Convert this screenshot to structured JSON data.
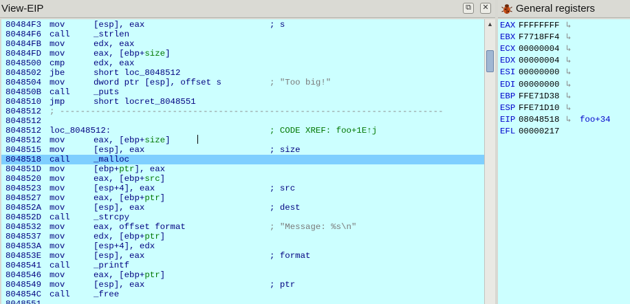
{
  "eip_view": {
    "title": "View-EIP",
    "restore_icon": "restore-window-icon",
    "close_icon": "close-window-icon",
    "lines": [
      {
        "addr": "80484F3",
        "mnem": "mov",
        "ops": "[esp], eax",
        "comment": "; s",
        "cstyle": ""
      },
      {
        "addr": "80484F6",
        "mnem": "call",
        "ops": "_strlen",
        "comment": "",
        "cstyle": ""
      },
      {
        "addr": "80484FB",
        "mnem": "mov",
        "ops": "edx, eax",
        "comment": "",
        "cstyle": ""
      },
      {
        "addr": "80484FD",
        "mnem": "mov",
        "ops": "eax, [ebp+size]",
        "comment": "",
        "cstyle": ""
      },
      {
        "addr": "8048500",
        "mnem": "cmp",
        "ops": "edx, eax",
        "comment": "",
        "cstyle": ""
      },
      {
        "addr": "8048502",
        "mnem": "jbe",
        "ops": "short loc_8048512",
        "comment": "",
        "cstyle": ""
      },
      {
        "addr": "8048504",
        "mnem": "mov",
        "ops": "dword ptr [esp], offset s",
        "comment": "; \"Too big!\"",
        "cstyle": "gray"
      },
      {
        "addr": "804850B",
        "mnem": "call",
        "ops": "_puts",
        "comment": "",
        "cstyle": ""
      },
      {
        "addr": "8048510",
        "mnem": "jmp",
        "ops": "short locret_8048551",
        "comment": "",
        "cstyle": ""
      },
      {
        "addr": "8048512",
        "mnem": "",
        "ops": "",
        "comment": "",
        "cstyle": "",
        "sep": "; ---------------------------------------------------------------------------"
      },
      {
        "addr": "8048512",
        "mnem": "",
        "ops": "",
        "comment": "",
        "cstyle": ""
      },
      {
        "addr": "8048512",
        "mnem": "loc_8048512:",
        "ops": "",
        "comment": "; CODE XREF: foo+1E↑j",
        "cstyle": "green"
      },
      {
        "addr": "8048512",
        "mnem": "mov",
        "ops": "eax, [ebp+size]",
        "comment": "",
        "cstyle": ""
      },
      {
        "addr": "8048515",
        "mnem": "mov",
        "ops": "[esp], eax",
        "comment": "; size",
        "cstyle": ""
      },
      {
        "addr": "8048518",
        "mnem": "call",
        "ops": "_malloc",
        "comment": "",
        "cstyle": "",
        "highlight": true
      },
      {
        "addr": "804851D",
        "mnem": "mov",
        "ops": "[ebp+ptr], eax",
        "comment": "",
        "cstyle": ""
      },
      {
        "addr": "8048520",
        "mnem": "mov",
        "ops": "eax, [ebp+src]",
        "comment": "",
        "cstyle": ""
      },
      {
        "addr": "8048523",
        "mnem": "mov",
        "ops": "[esp+4], eax",
        "comment": "; src",
        "cstyle": ""
      },
      {
        "addr": "8048527",
        "mnem": "mov",
        "ops": "eax, [ebp+ptr]",
        "comment": "",
        "cstyle": ""
      },
      {
        "addr": "804852A",
        "mnem": "mov",
        "ops": "[esp], eax",
        "comment": "; dest",
        "cstyle": ""
      },
      {
        "addr": "804852D",
        "mnem": "call",
        "ops": "_strcpy",
        "comment": "",
        "cstyle": ""
      },
      {
        "addr": "8048532",
        "mnem": "mov",
        "ops": "eax, offset format",
        "comment": "; \"Message: %s\\n\"",
        "cstyle": "gray"
      },
      {
        "addr": "8048537",
        "mnem": "mov",
        "ops": "edx, [ebp+ptr]",
        "comment": "",
        "cstyle": ""
      },
      {
        "addr": "804853A",
        "mnem": "mov",
        "ops": "[esp+4], edx",
        "comment": "",
        "cstyle": ""
      },
      {
        "addr": "804853E",
        "mnem": "mov",
        "ops": "[esp], eax",
        "comment": "; format",
        "cstyle": ""
      },
      {
        "addr": "8048541",
        "mnem": "call",
        "ops": "_printf",
        "comment": "",
        "cstyle": ""
      },
      {
        "addr": "8048546",
        "mnem": "mov",
        "ops": "eax, [ebp+ptr]",
        "comment": "",
        "cstyle": ""
      },
      {
        "addr": "8048549",
        "mnem": "mov",
        "ops": "[esp], eax",
        "comment": "; ptr",
        "cstyle": ""
      },
      {
        "addr": "804854C",
        "mnem": "call",
        "ops": "_free",
        "comment": "",
        "cstyle": ""
      },
      {
        "addr": "8048551",
        "mnem": "",
        "ops": "",
        "comment": "",
        "cstyle": ""
      }
    ]
  },
  "registers": {
    "title": "General registers",
    "title_icon": "bug-icon",
    "jump_icon": "jump-arrow-icon",
    "items": [
      {
        "name": "EAX",
        "value": "FFFFFFFF",
        "arrow": "↳",
        "target": ""
      },
      {
        "name": "EBX",
        "value": "F7718FF4",
        "arrow": "↳",
        "target": ""
      },
      {
        "name": "ECX",
        "value": "00000004",
        "arrow": "↳",
        "target": ""
      },
      {
        "name": "EDX",
        "value": "00000004",
        "arrow": "↳",
        "target": ""
      },
      {
        "name": "ESI",
        "value": "00000000",
        "arrow": "↳",
        "target": ""
      },
      {
        "name": "EDI",
        "value": "00000000",
        "arrow": "↳",
        "target": ""
      },
      {
        "name": "EBP",
        "value": "FFE71D38",
        "arrow": "↳",
        "target": ""
      },
      {
        "name": "ESP",
        "value": "FFE71D10",
        "arrow": "↳",
        "target": ""
      },
      {
        "name": "EIP",
        "value": "08048518",
        "arrow": "↳",
        "target": "foo+34"
      },
      {
        "name": "EFL",
        "value": "00000217",
        "arrow": "",
        "target": ""
      }
    ]
  },
  "colors": {
    "listing_bg": "#ccffff",
    "highlight_bg": "#7fcfff",
    "code_text": "#000080",
    "comment_green": "#007700",
    "string_gray": "#7a7a7a"
  }
}
